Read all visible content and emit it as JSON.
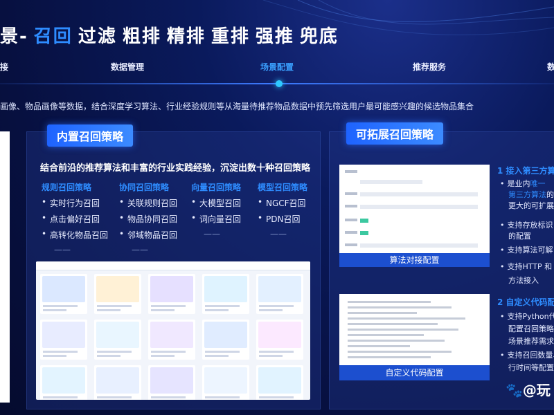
{
  "title": {
    "prefix": "景-",
    "words": [
      "召回",
      "过滤",
      "粗排",
      "精排",
      "重排",
      "强推",
      "兜底"
    ]
  },
  "nav": {
    "tabs": [
      "接",
      "数据管理",
      "场景配置",
      "推荐服务",
      "数"
    ],
    "active_index": 2
  },
  "description": "画像、物品画像等数据，结合深度学习算法、行业经验规则等从海量待推荐物品数据中预先筛选用户最可能感兴趣的候选物品集合",
  "builtin": {
    "badge": "内置召回策略",
    "subtitle": "结合前沿的推荐算法和丰富的行业实践经验，沉淀出数十种召回策略",
    "columns": [
      {
        "header": "规则召回策略",
        "items": [
          "实时行为召回",
          "点击偏好召回",
          "高转化物品召回"
        ],
        "dash": "——"
      },
      {
        "header": "协同召回策略",
        "items": [
          "关联规则召回",
          "物品协同召回",
          "邻域物品召回"
        ],
        "dash": "——"
      },
      {
        "header": "向量召回策略",
        "items": [
          "大模型召回",
          "词向量召回"
        ],
        "dash": "——"
      },
      {
        "header": "模型召回策略",
        "items": [
          "NGCF召回",
          "PDN召回"
        ],
        "dash": "——"
      }
    ]
  },
  "extensible": {
    "badge": "可拓展召回策略",
    "config_label": "算法对接配置",
    "code_label": "自定义代码配置",
    "section1_title": "1 接入第三方算",
    "section1_items": [
      {
        "pre": "是业内",
        "hl": "唯一",
        "post": ""
      },
      {
        "pre": "",
        "hl": "第三方算法",
        "post": "的"
      },
      {
        "pre": "更大的可扩展",
        "hl": "",
        "post": ""
      }
    ],
    "section1_bullets": [
      "支持存放标识",
      "的配置",
      "支持算法可解",
      "支持HTTP 和",
      "方法接入"
    ],
    "section2_title": "2 自定义代码配",
    "section2_bullets": [
      "支持Python代码",
      "配置召回策略，",
      "场景推荐需求",
      "支持召回数量、",
      "行时间等配置"
    ]
  },
  "watermark": "@玩",
  "colors": {
    "accent": "#2e8cff",
    "bg": "#0a1a5c",
    "bar": "#1c4fcf"
  }
}
